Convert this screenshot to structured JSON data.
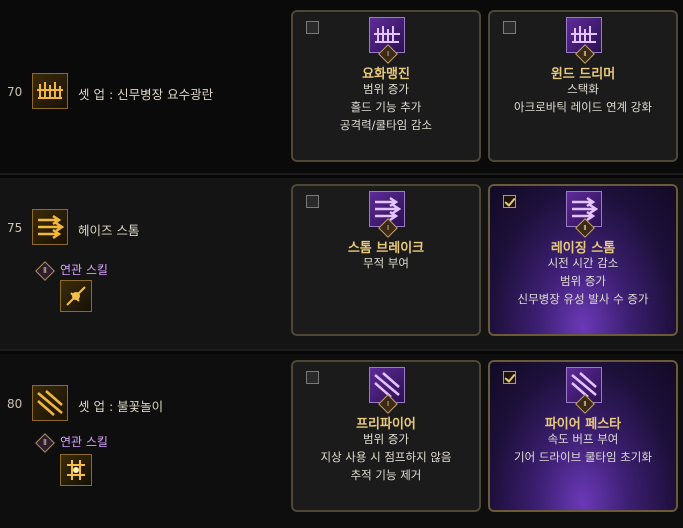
{
  "colors": {
    "title_gold": "#e7c97a",
    "related_purple": "#d7a3ff",
    "card_border": "#4e4636"
  },
  "rows": [
    {
      "level": "70",
      "skill_name": "셋 업 : 신무병장 요수광란",
      "skill_icon": "weapon-rack-icon",
      "options": [
        {
          "selected": false,
          "title": "요화맹진",
          "rank": "Ⅰ",
          "icon": "purple-rack-icon",
          "desc": [
            "범위 증가",
            "홀드 기능 추가",
            "공격력/쿨타임 감소"
          ]
        },
        {
          "selected": false,
          "title": "윈드 드리머",
          "rank": "Ⅱ",
          "icon": "purple-rack-icon",
          "desc": [
            "스택화",
            "아크로바틱 레이드 연계 강화"
          ]
        }
      ]
    },
    {
      "level": "75",
      "skill_name": "헤이즈 스톰",
      "skill_icon": "triple-arrow-icon",
      "related_rank": "Ⅱ",
      "related_label": "연관 스킬",
      "related_icon": "spinning-blade-icon",
      "options": [
        {
          "selected": false,
          "title": "스톰 브레이크",
          "rank": "Ⅰ",
          "icon": "purple-arrow-icon",
          "desc": [
            "무적 부여"
          ]
        },
        {
          "selected": true,
          "title": "레이징 스톰",
          "rank": "Ⅱ",
          "icon": "purple-arrow-icon",
          "desc": [
            "시전 시간 감소",
            "범위 증가",
            "신무병장 유성 발사 수 증가"
          ]
        }
      ]
    },
    {
      "level": "80",
      "skill_name": "셋 업 : 불꽃놀이",
      "skill_icon": "diagonal-bolts-icon",
      "related_rank": "Ⅱ",
      "related_label": "연관 스킬",
      "related_icon": "grid-burst-icon",
      "options": [
        {
          "selected": false,
          "title": "프리파이어",
          "rank": "Ⅰ",
          "icon": "purple-bolts-icon",
          "desc": [
            "범위 증가",
            "지상 사용 시 점프하지 않음",
            "추적 기능 제거"
          ]
        },
        {
          "selected": true,
          "title": "파이어 페스타",
          "rank": "Ⅱ",
          "icon": "purple-bolts-icon",
          "desc": [
            "속도 버프 부여",
            "기어 드라이브 쿨타임 초기화"
          ]
        }
      ]
    }
  ]
}
